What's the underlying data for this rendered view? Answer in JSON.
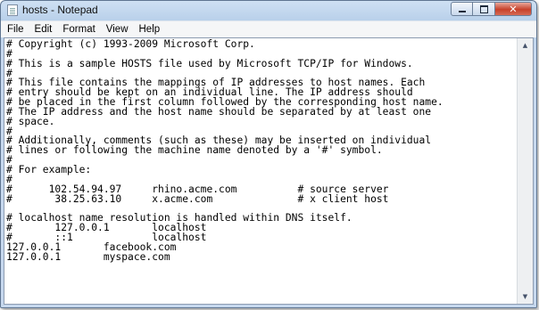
{
  "window": {
    "title": "hosts - Notepad"
  },
  "menu": [
    "File",
    "Edit",
    "Format",
    "View",
    "Help"
  ],
  "caption": {
    "close_glyph": "✕",
    "up_arrow": "▲",
    "down_arrow": "▼"
  },
  "content": {
    "lines": [
      "# Copyright (c) 1993-2009 Microsoft Corp.",
      "#",
      "# This is a sample HOSTS file used by Microsoft TCP/IP for Windows.",
      "#",
      "# This file contains the mappings of IP addresses to host names. Each",
      "# entry should be kept on an individual line. The IP address should",
      "# be placed in the first column followed by the corresponding host name.",
      "# The IP address and the host name should be separated by at least one",
      "# space.",
      "#",
      "# Additionally, comments (such as these) may be inserted on individual",
      "# lines or following the machine name denoted by a '#' symbol.",
      "#",
      "# For example:",
      "#",
      "#      102.54.94.97     rhino.acme.com          # source server",
      "#       38.25.63.10     x.acme.com              # x client host",
      "",
      "# localhost name resolution is handled within DNS itself.",
      "#       127.0.0.1       localhost",
      "#       ::1             localhost",
      "127.0.0.1       facebook.com",
      "127.0.0.1       myspace.com"
    ]
  }
}
